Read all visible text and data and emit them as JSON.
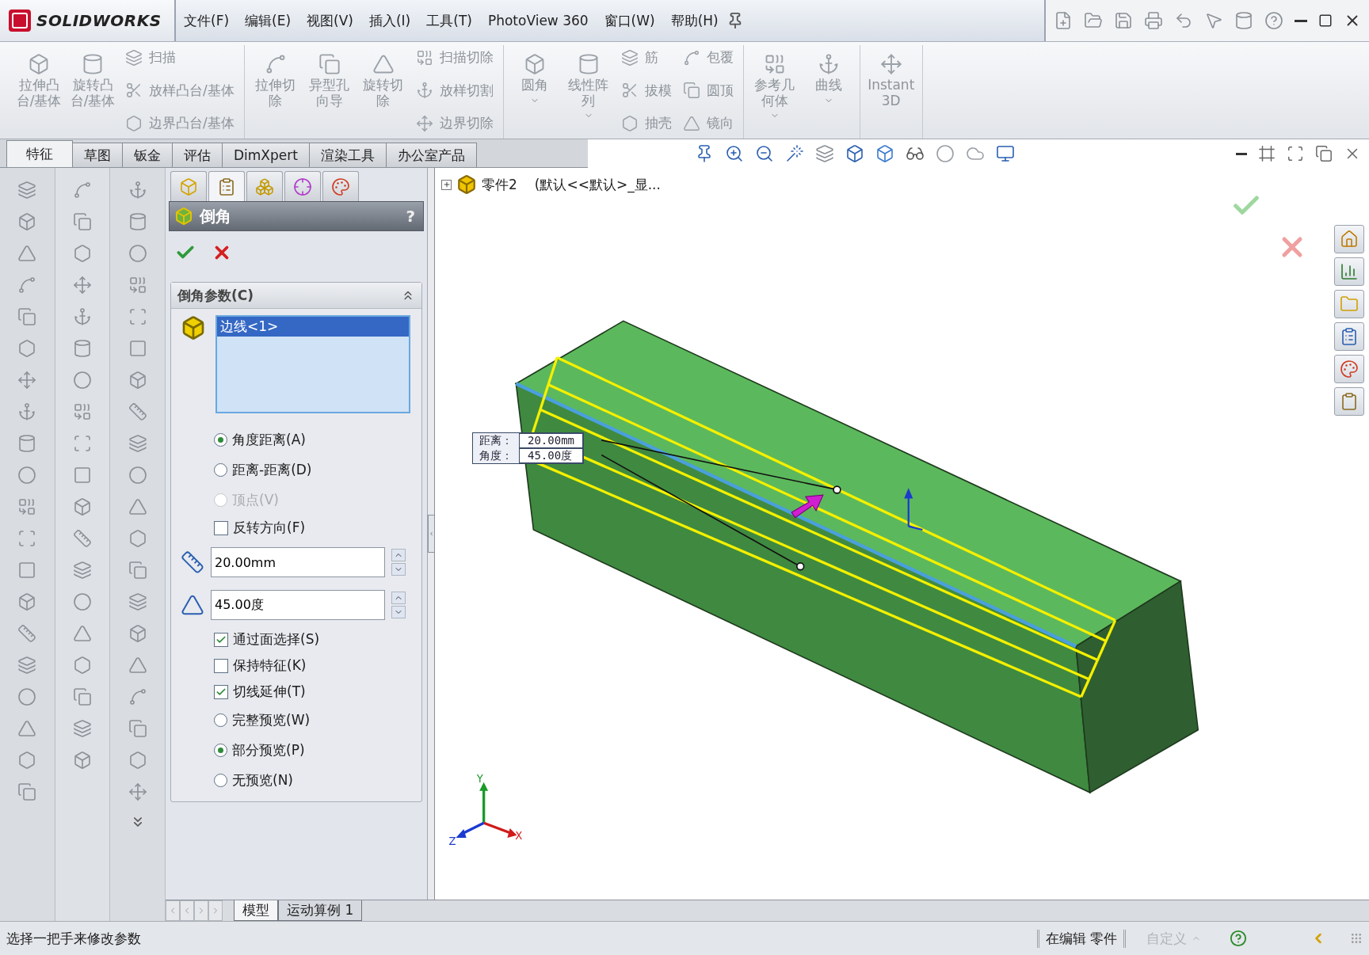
{
  "app": {
    "logo": "SOLIDWORKS",
    "menu": [
      "文件(F)",
      "编辑(E)",
      "视图(V)",
      "插入(I)",
      "工具(T)",
      "PhotoView 360",
      "窗口(W)",
      "帮助(H)"
    ]
  },
  "ribbon": {
    "groups": [
      {
        "items": [
          {
            "kind": "large",
            "label": "拉伸凸台/基体",
            "disabled": true,
            "dropdown": false
          },
          {
            "kind": "large",
            "label": "旋转凸台/基体",
            "disabled": true,
            "dropdown": false
          },
          {
            "kind": "small",
            "label": "扫描",
            "disabled": true
          },
          {
            "kind": "small",
            "label": "放样凸台/基体",
            "disabled": true
          },
          {
            "kind": "small",
            "label": "边界凸台/基体",
            "disabled": true
          }
        ]
      },
      {
        "items": [
          {
            "kind": "large",
            "label": "拉伸切除",
            "disabled": true,
            "dropdown": false
          },
          {
            "kind": "large",
            "label": "异型孔向导",
            "disabled": true,
            "dropdown": false
          },
          {
            "kind": "large",
            "label": "旋转切除",
            "disabled": true,
            "dropdown": false
          },
          {
            "kind": "small",
            "label": "扫描切除",
            "disabled": true
          },
          {
            "kind": "small",
            "label": "放样切割",
            "disabled": true
          },
          {
            "kind": "small",
            "label": "边界切除",
            "disabled": true
          }
        ]
      },
      {
        "items": [
          {
            "kind": "large",
            "label": "圆角",
            "disabled": true,
            "dropdown": true
          },
          {
            "kind": "large",
            "label": "线性阵列",
            "disabled": true,
            "dropdown": true
          },
          {
            "kind": "small",
            "label": "筋",
            "disabled": true
          },
          {
            "kind": "small",
            "label": "拔模",
            "disabled": true
          },
          {
            "kind": "small",
            "label": "抽壳",
            "disabled": true
          },
          {
            "kind": "small",
            "label": "包覆",
            "disabled": true
          },
          {
            "kind": "small",
            "label": "圆顶",
            "disabled": true
          },
          {
            "kind": "small",
            "label": "镜向",
            "disabled": true
          }
        ]
      },
      {
        "items": [
          {
            "kind": "large",
            "label": "参考几何体",
            "disabled": true,
            "dropdown": true
          },
          {
            "kind": "large",
            "label": "曲线",
            "disabled": true,
            "dropdown": true
          }
        ]
      },
      {
        "items": [
          {
            "kind": "large",
            "label": "Instant3D",
            "disabled": true,
            "dropdown": false
          }
        ]
      }
    ]
  },
  "command_tabs": [
    {
      "label": "特征",
      "selected": true
    },
    {
      "label": "草图",
      "selected": false
    },
    {
      "label": "钣金",
      "selected": false
    },
    {
      "label": "评估",
      "selected": false
    },
    {
      "label": "DimXpert",
      "selected": false
    },
    {
      "label": "渲染工具",
      "selected": false
    },
    {
      "label": "办公室产品",
      "selected": false
    }
  ],
  "property_manager": {
    "tabs": [
      {
        "selected": false
      },
      {
        "selected": true
      },
      {
        "selected": false
      },
      {
        "selected": false
      },
      {
        "selected": false
      }
    ],
    "title": "倒角",
    "help": "?",
    "section": {
      "title": "倒角参数(C)",
      "expanded": true,
      "selection": [
        {
          "label": "边线<1>",
          "selected": true
        }
      ],
      "controls": [
        {
          "kind": "radio",
          "label": "角度距离(A)",
          "selected": true,
          "disabled": false
        },
        {
          "kind": "radio",
          "label": "距离-距离(D)",
          "selected": false,
          "disabled": false
        },
        {
          "kind": "radio",
          "label": "顶点(V)",
          "selected": false,
          "disabled": true
        },
        {
          "kind": "checkbox",
          "label": "反转方向(F)",
          "checked": false
        },
        {
          "kind": "number",
          "value": "20.00mm"
        },
        {
          "kind": "number",
          "value": "45.00度"
        },
        {
          "kind": "checkbox",
          "label": "通过面选择(S)",
          "checked": true
        },
        {
          "kind": "checkbox",
          "label": "保持特征(K)",
          "checked": false
        },
        {
          "kind": "checkbox",
          "label": "切线延伸(T)",
          "checked": true
        },
        {
          "kind": "radio",
          "label": "完整预览(W)",
          "selected": false,
          "disabled": false
        },
        {
          "kind": "radio",
          "label": "部分预览(P)",
          "selected": true,
          "disabled": false
        },
        {
          "kind": "radio",
          "label": "无预览(N)",
          "selected": false,
          "disabled": false
        }
      ]
    }
  },
  "viewport": {
    "tree": {
      "expanded": false,
      "name": "零件2",
      "config": "(默认<<默认>_显..."
    },
    "callout": [
      {
        "label": "距离：",
        "value": "20.00mm"
      },
      {
        "label": "角度：",
        "value": "45.00度"
      }
    ],
    "axes": [
      "X",
      "Y",
      "Z"
    ]
  },
  "bottom_tabs": [
    {
      "label": "模型",
      "selected": true
    },
    {
      "label": "运动算例 1",
      "selected": false
    }
  ],
  "status_bar": {
    "message": "选择一把手来修改参数",
    "mode": "在编辑 零件",
    "custom": {
      "label": "自定义",
      "disabled": true
    }
  }
}
